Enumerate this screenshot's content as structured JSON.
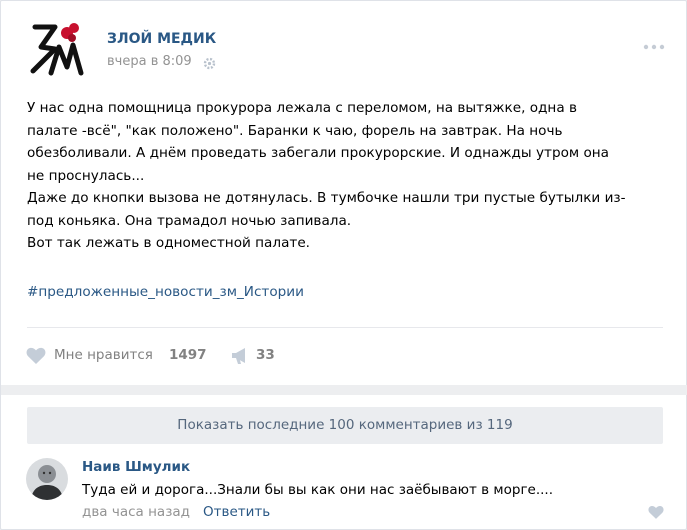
{
  "post": {
    "group_name": "ЗЛОЙ МЕДИК",
    "time": "вчера в 8:09",
    "logo_letters": "ЗМ",
    "text_lines": [
      "У нас одна помощница прокурора лежала с переломом, на вытяжке, одна в",
      "палате -всё\", \"как положено\". Баранки к чаю, форель на завтрак. На ночь",
      "обезболивали. А днём проведать забегали прокурорские. И однажды утром она",
      "не проснулась...",
      "Даже до кнопки вызова не дотянулась. В тумбочке нашли три пустые бутылки из-",
      "под коньяка. Она трамадол ночью запивала.",
      "Вот так лежать в одноместной палате."
    ],
    "hashtag": "#предложенные_новости_зм_Истории"
  },
  "actions": {
    "like_label": "Мне нравится",
    "like_count": "1497",
    "share_count": "33"
  },
  "comments": {
    "show_more_label": "Показать последние 100 комментариев из 119",
    "items": [
      {
        "author": "Наив Шмулик",
        "text": "Туда ей и дорога...Знали бы вы как они нас заёбывают в морге....",
        "time": "два часа назад",
        "reply_label": "Ответить"
      }
    ]
  },
  "colors": {
    "link": "#2a5885",
    "muted": "#939393",
    "logo_red": "#c8102e"
  },
  "icons": [
    "gear-icon",
    "more-dots-icon",
    "heart-icon",
    "megaphone-icon"
  ]
}
